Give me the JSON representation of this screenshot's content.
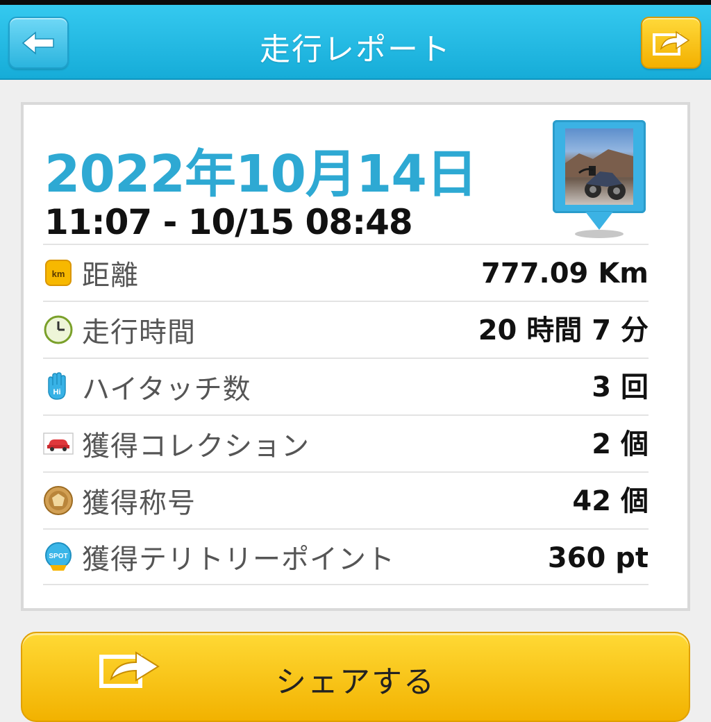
{
  "header": {
    "title": "走行レポート"
  },
  "report": {
    "date": "2022年10月14日",
    "time_range": "11:07 - 10/15 08:48",
    "rows": [
      {
        "icon": "km-icon",
        "label": "距離",
        "value": "777.09 Km"
      },
      {
        "icon": "clock-icon",
        "label": "走行時間",
        "value": "20 時間 7 分"
      },
      {
        "icon": "hi-hand-icon",
        "label": "ハイタッチ数",
        "value": "3 回"
      },
      {
        "icon": "car-icon",
        "label": "獲得コレクション",
        "value": "2 個"
      },
      {
        "icon": "medal-icon",
        "label": "獲得称号",
        "value": "42 個"
      },
      {
        "icon": "spot-icon",
        "label": "獲得テリトリーポイント",
        "value": "360 pt"
      }
    ]
  },
  "km_badge_text": "km",
  "spot_badge_text": "SPOT",
  "hi_badge_text": "Hi",
  "footer": {
    "share_label": "シェアする"
  },
  "colors": {
    "header": "#1fb4e0",
    "date": "#2ea9d3",
    "share_button": "#f5bd00"
  }
}
